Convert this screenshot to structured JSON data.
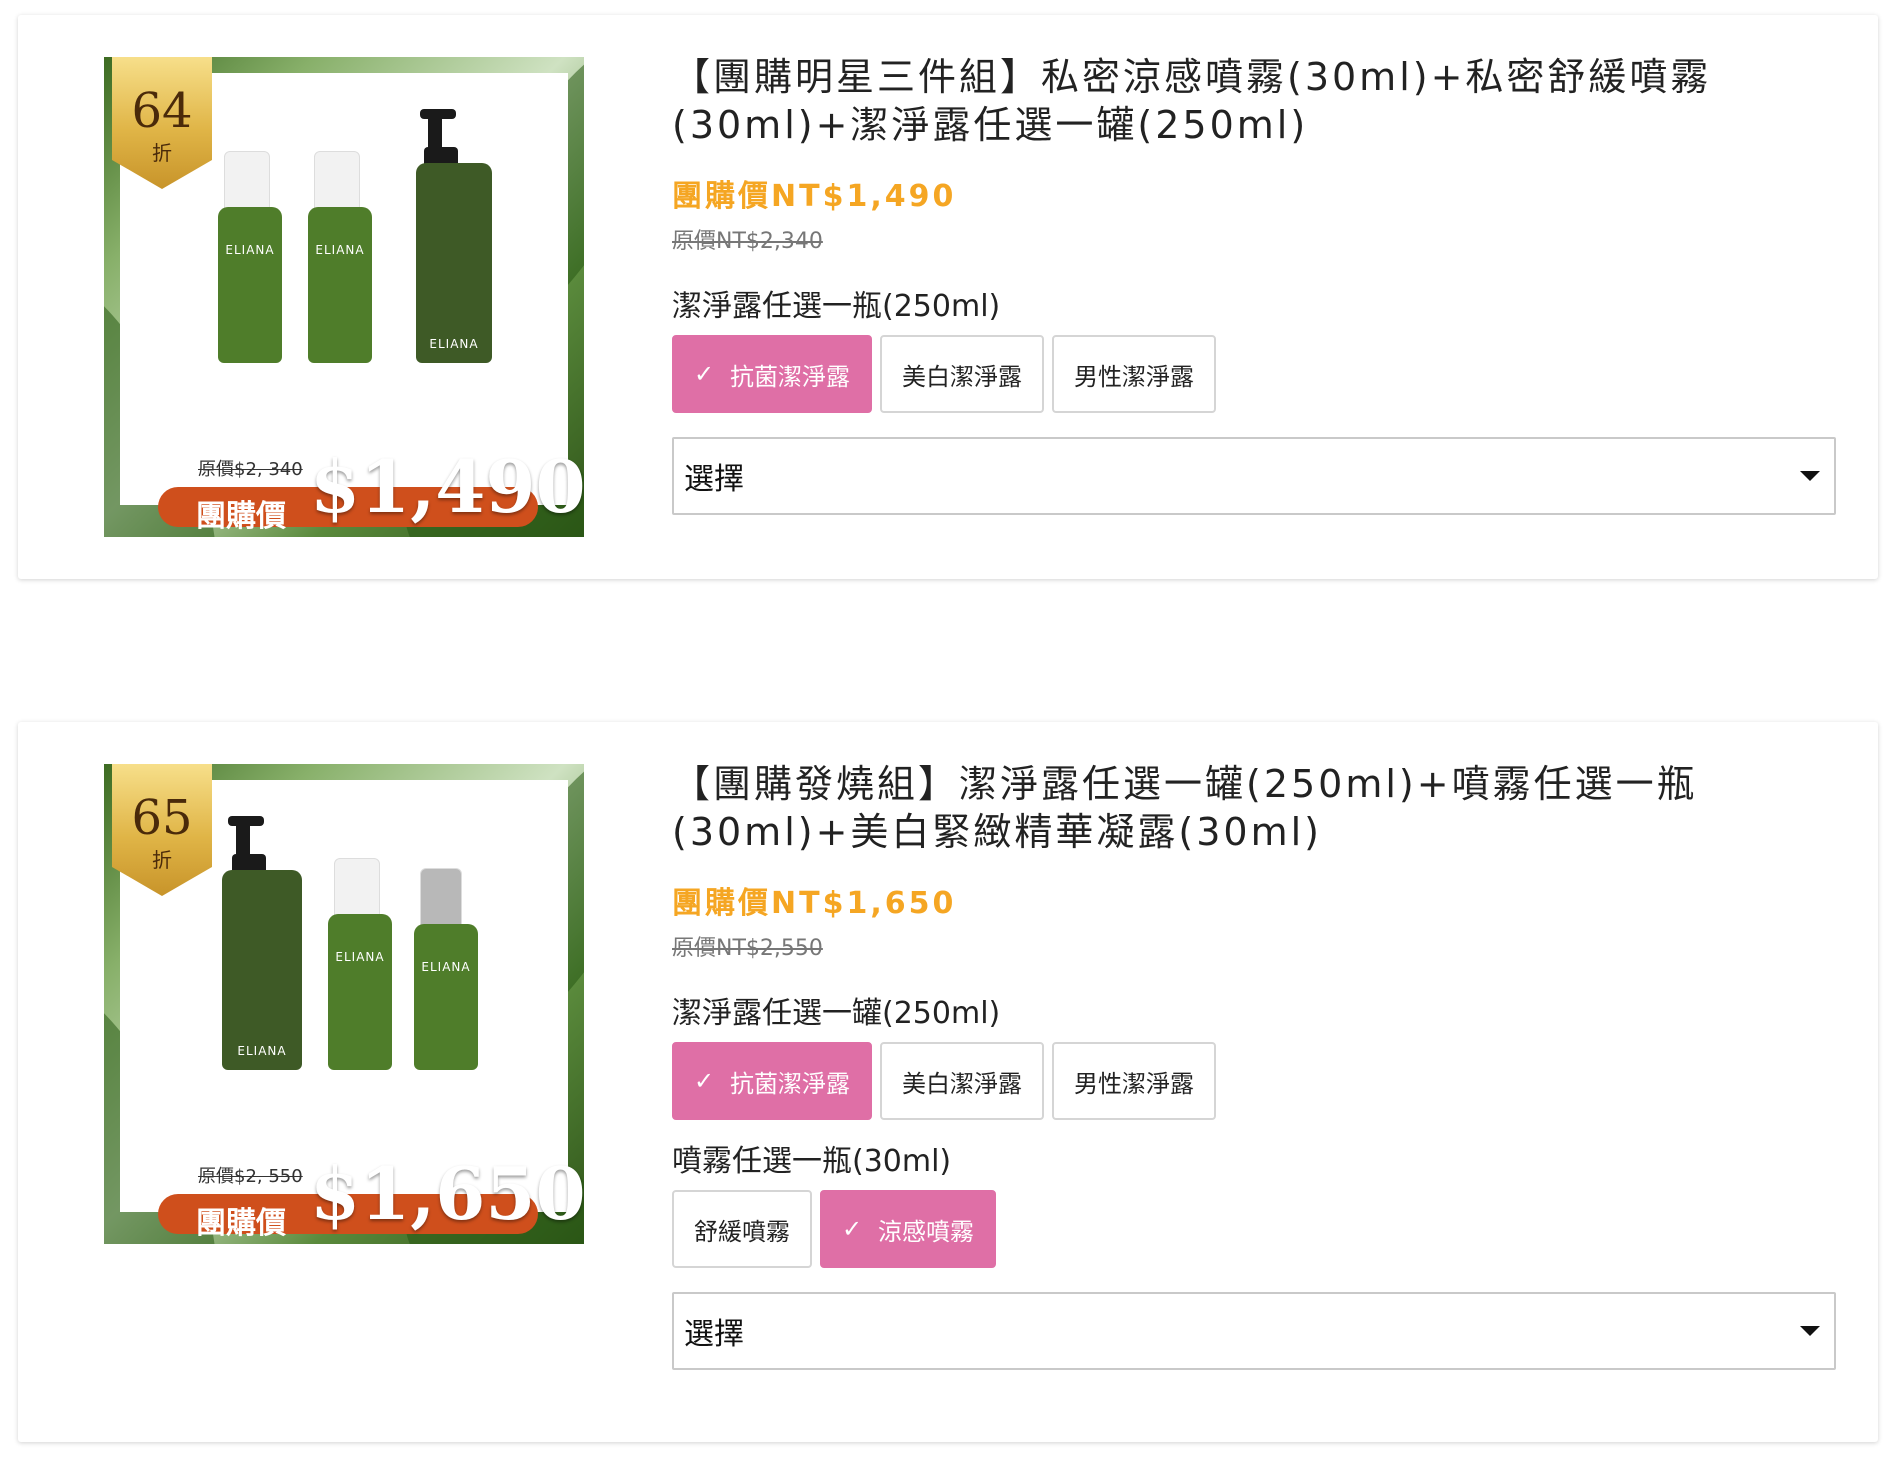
{
  "products": [
    {
      "badge_number": "64",
      "badge_unit": "折",
      "image_old_price": "原價$2, 340",
      "image_price_label": "團購價",
      "image_price": "$1,490",
      "bottle_brand": "ELIANA",
      "title_line1": "【團購明星三件組】私密涼感噴霧(30ml)+私密舒緩噴霧",
      "title_line2": "(30ml)+潔淨露任選一罐(250ml)",
      "group_price": "團購價NT$1,490",
      "original_price": "原價NT$2,340",
      "option_group_1_label": "潔淨露任選一瓶(250ml)",
      "option_group_1": [
        "抗菌潔淨露",
        "美白潔淨露",
        "男性潔淨露"
      ],
      "select_placeholder": "選擇"
    },
    {
      "badge_number": "65",
      "badge_unit": "折",
      "image_old_price": "原價$2, 550",
      "image_price_label": "團購價",
      "image_price": "$1,650",
      "bottle_brand": "ELIANA",
      "title_line1": "【團購發燒組】潔淨露任選一罐(250ml)+噴霧任選一瓶",
      "title_line2": "(30ml)+美白緊緻精華凝露(30ml)",
      "group_price": "團購價NT$1,650",
      "original_price": "原價NT$2,550",
      "option_group_1_label": "潔淨露任選一罐(250ml)",
      "option_group_1": [
        "抗菌潔淨露",
        "美白潔淨露",
        "男性潔淨露"
      ],
      "option_group_2_label": "噴霧任選一瓶(30ml)",
      "option_group_2": [
        "舒緩噴霧",
        "涼感噴霧"
      ],
      "select_placeholder": "選擇"
    }
  ],
  "icons": {
    "selected": "check-icon",
    "dropdown": "caret-down-icon"
  },
  "colors": {
    "price": "#f5a623",
    "selected_option": "#df6fa6",
    "ribbon": "#cf4f1c",
    "bottle_green": "#4f7d2a",
    "badge_gold": "#e0b547"
  }
}
